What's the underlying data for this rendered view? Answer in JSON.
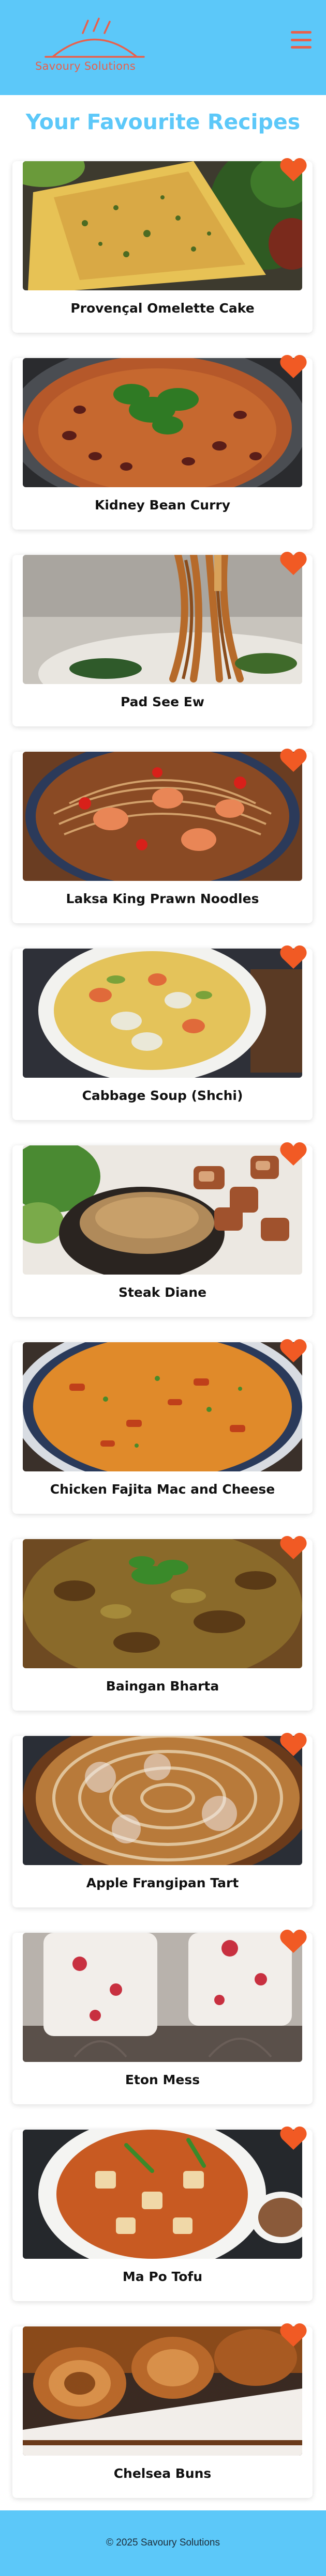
{
  "header": {
    "brand": "Savoury Solutions",
    "logo_icon": "cooking-pot-icon",
    "menu_icon": "hamburger-menu-icon",
    "brand_color": "#5cc8f9",
    "accent_color": "#e9604c"
  },
  "main": {
    "title": "Your Favourite Recipes",
    "favourite_icon": "heart-icon",
    "recipes": [
      {
        "title": "Provençal Omelette Cake"
      },
      {
        "title": "Kidney Bean Curry"
      },
      {
        "title": "Pad See Ew"
      },
      {
        "title": "Laksa King Prawn Noodles"
      },
      {
        "title": "Cabbage Soup (Shchi)"
      },
      {
        "title": "Steak Diane"
      },
      {
        "title": "Chicken Fajita Mac and Cheese"
      },
      {
        "title": "Baingan Bharta"
      },
      {
        "title": "Apple Frangipan Tart"
      },
      {
        "title": "Eton Mess"
      },
      {
        "title": "Ma Po Tofu"
      },
      {
        "title": "Chelsea Buns"
      }
    ]
  },
  "footer": {
    "copyright": "© 2025 Savoury Solutions"
  }
}
